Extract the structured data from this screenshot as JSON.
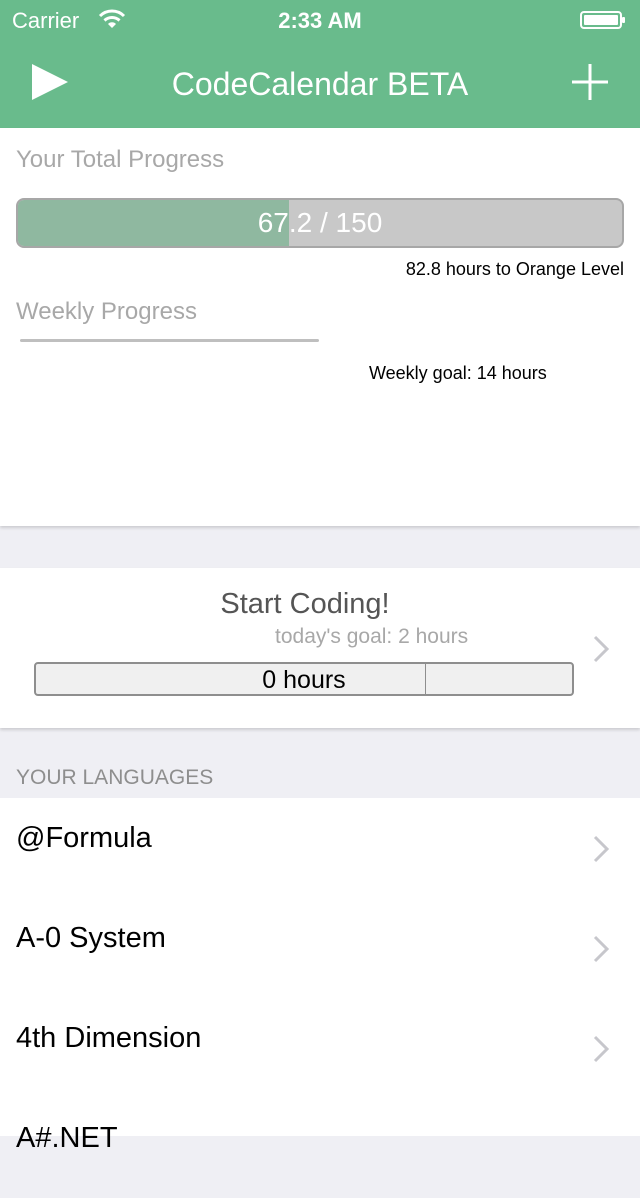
{
  "status_bar": {
    "carrier": "Carrier",
    "time": "2:33 AM"
  },
  "nav": {
    "title": "CodeCalendar BETA",
    "left_icon": "play-icon",
    "right_icon": "plus-icon"
  },
  "colors": {
    "brand": "#69bb8c",
    "progress_fill": "#8fb8a0"
  },
  "total_progress": {
    "label": "Your Total Progress",
    "text": "67.2 / 150",
    "value": 67.2,
    "max": 150,
    "to_next_level": "82.8 hours to Orange Level"
  },
  "weekly_progress": {
    "label": "Weekly Progress",
    "goal_text": "Weekly goal: 14 hours"
  },
  "start_coding": {
    "title": "Start Coding!",
    "goal_text": "today's goal: 2 hours",
    "hours_text": "0 hours"
  },
  "languages": {
    "header": "YOUR LANGUAGES",
    "items": [
      "@Formula",
      "A-0 System",
      "4th Dimension",
      "A#.NET"
    ]
  }
}
